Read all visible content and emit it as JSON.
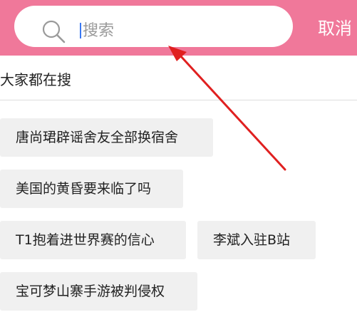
{
  "header": {
    "search": {
      "placeholder": "搜索",
      "value": ""
    },
    "cancel_label": "取消"
  },
  "hot_search": {
    "title": "大家都在搜",
    "tags": [
      "唐尚珺辟谣舍友全部换宿舍",
      "美国的黄昏要来临了吗",
      "T1抱着进世界赛的信心",
      "李斌入驻B站",
      "宝可梦山寨手游被判侵权"
    ]
  },
  "colors": {
    "header_bg": "#f0789a",
    "annotation_arrow": "#e02020",
    "tag_bg": "#f0f0f0",
    "caret": "#3a78f2"
  }
}
